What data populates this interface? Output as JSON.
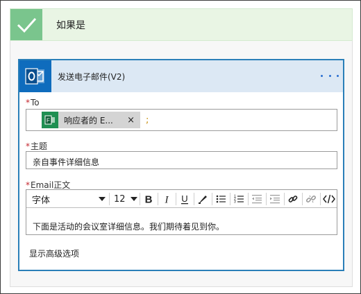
{
  "condition": {
    "title": "如果是"
  },
  "action": {
    "title": "发送电子邮件(V2)",
    "more_icon": "ellipsis-icon"
  },
  "to": {
    "label": "To",
    "chip_text": "响应者的 E...",
    "chip_remove": "×",
    "separator": ";"
  },
  "subject": {
    "label": "主题",
    "value": "亲自事件详细信息"
  },
  "body": {
    "label": "Email正文",
    "font_label": "字体",
    "size_label": "12",
    "text": "下面是活动的会议室详细信息。我们期待着见到你。"
  },
  "advanced_label": "显示高级选项",
  "colors": {
    "accent": "#2a7fb8",
    "check_green": "#7ac58d",
    "outlook_blue": "#0f6cbd",
    "forms_green": "#1f8f52",
    "required": "#c4262e"
  }
}
